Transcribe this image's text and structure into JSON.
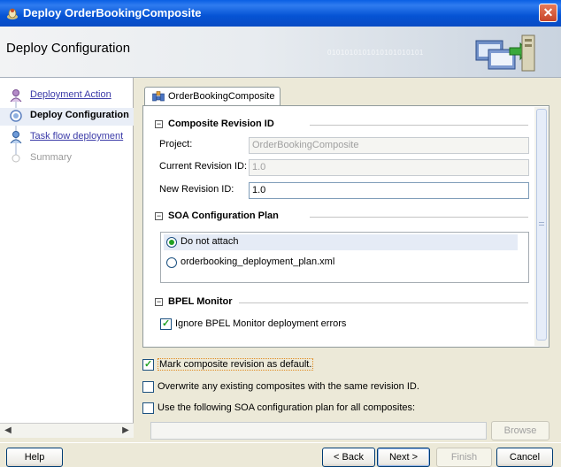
{
  "window": {
    "title": "Deploy OrderBookingComposite",
    "close_symbol": "✕"
  },
  "header": {
    "title": "Deploy Configuration",
    "binary_text": "0101010101010101010101"
  },
  "nav": {
    "items": [
      {
        "label": "Deployment Action",
        "state": "link"
      },
      {
        "label": "Deploy Configuration",
        "state": "current"
      },
      {
        "label": "Task flow deployment",
        "state": "link"
      },
      {
        "label": "Summary",
        "state": "disabled"
      }
    ]
  },
  "tab": {
    "label": "OrderBookingComposite"
  },
  "composite_revision": {
    "heading": "Composite Revision ID",
    "project_label": "Project:",
    "project_value": "OrderBookingComposite",
    "current_label": "Current Revision ID:",
    "current_value": "1.0",
    "new_label": "New Revision ID:",
    "new_value": "1.0"
  },
  "soa_plan": {
    "heading": "SOA Configuration Plan",
    "options": [
      {
        "label": "Do not attach",
        "selected": true
      },
      {
        "label": "orderbooking_deployment_plan.xml",
        "selected": false
      }
    ]
  },
  "bpel_monitor": {
    "heading": "BPEL Monitor",
    "ignore_label": "Ignore BPEL Monitor deployment errors",
    "ignore_checked": true
  },
  "options": {
    "mark_default": "Mark composite revision as default.",
    "overwrite": "Overwrite any existing composites with the same revision ID.",
    "use_plan": "Use the following SOA configuration plan for all composites:"
  },
  "buttons": {
    "browse": "Browse",
    "help": "Help",
    "back": "< Back",
    "next": "Next >",
    "finish": "Finish",
    "cancel": "Cancel"
  },
  "colors": {
    "title_bar": "#0a5fe4",
    "link": "#3b3ba8",
    "check": "#21a121"
  }
}
